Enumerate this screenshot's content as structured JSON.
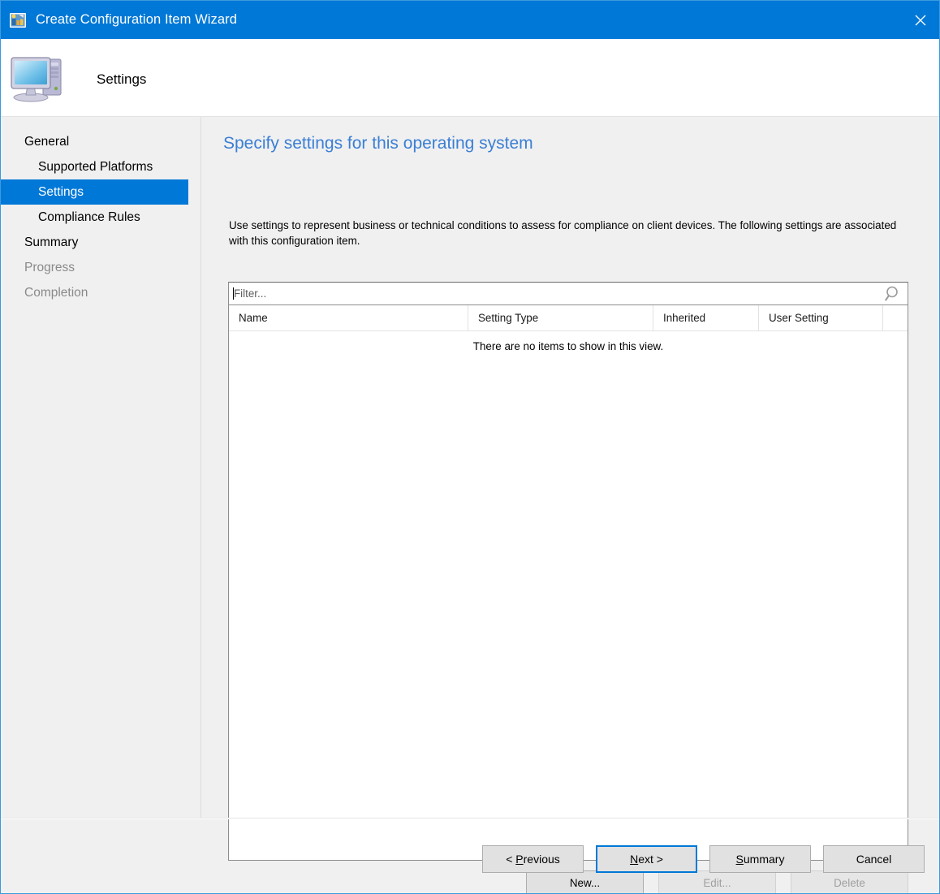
{
  "window": {
    "title": "Create Configuration Item Wizard",
    "icon": "configuration-item-icon",
    "close_label": "✕"
  },
  "header": {
    "title": "Settings",
    "icon": "computer-icon"
  },
  "sidebar": {
    "items": [
      {
        "label": "General",
        "indent": false,
        "selected": false,
        "disabled": false
      },
      {
        "label": "Supported Platforms",
        "indent": true,
        "selected": false,
        "disabled": false
      },
      {
        "label": "Settings",
        "indent": true,
        "selected": true,
        "disabled": false
      },
      {
        "label": "Compliance Rules",
        "indent": true,
        "selected": false,
        "disabled": false
      },
      {
        "label": "Summary",
        "indent": false,
        "selected": false,
        "disabled": false
      },
      {
        "label": "Progress",
        "indent": false,
        "selected": false,
        "disabled": true
      },
      {
        "label": "Completion",
        "indent": false,
        "selected": false,
        "disabled": true
      }
    ]
  },
  "main": {
    "heading": "Specify settings for this operating system",
    "description": "Use settings to represent business or technical conditions to assess for compliance on client devices. The following settings are associated with this configuration item.",
    "filter": {
      "placeholder": "Filter...",
      "value": "",
      "search_icon": "magnifier-icon"
    },
    "list": {
      "columns": [
        "Name",
        "Setting Type",
        "Inherited",
        "User Setting"
      ],
      "rows": [],
      "empty_message": "There are no items to show in this view."
    },
    "actions": [
      {
        "label": "New...",
        "enabled": true
      },
      {
        "label": "Edit...",
        "enabled": false
      },
      {
        "label": "Delete",
        "enabled": false
      }
    ]
  },
  "footer": {
    "buttons": [
      {
        "label_pre": "< ",
        "accel": "P",
        "label_post": "revious",
        "default": false
      },
      {
        "label_pre": "",
        "accel": "N",
        "label_post": "ext >",
        "default": true
      },
      {
        "label_pre": "",
        "accel": "S",
        "label_post": "ummary",
        "default": false
      },
      {
        "label_pre": "",
        "accel": "",
        "label_post": "Cancel",
        "default": false
      }
    ]
  },
  "colors": {
    "titlebar": "#0078d7",
    "accent": "#0078d7",
    "heading": "#3a7fd5",
    "body_bg": "#f0f0f0",
    "window_border": "#3a9ade"
  }
}
